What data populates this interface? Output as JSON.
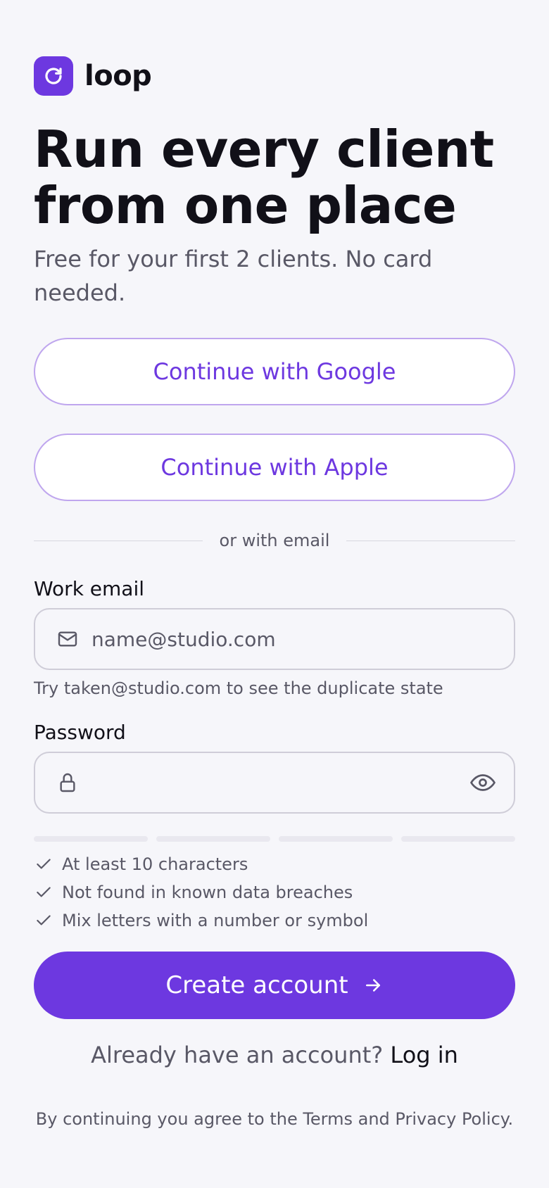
{
  "brand": {
    "name": "loop",
    "icon": "refresh-icon",
    "color": "#6d38e0"
  },
  "hero": {
    "title": "Run every client from one place",
    "subtitle": "Free for your first 2 clients. No card needed."
  },
  "oauth": {
    "google_label": "Continue with Google",
    "apple_label": "Continue with Apple"
  },
  "divider_text": "or with email",
  "email": {
    "label": "Work email",
    "placeholder": "name@studio.com",
    "icon": "mail-icon",
    "hint": "Try taken@studio.com to see the duplicate state"
  },
  "password": {
    "label": "Password",
    "value": "",
    "icon": "lock-icon",
    "toggle_icon": "eye-icon",
    "strength_segments_filled": 0,
    "strength_segments_total": 4,
    "rules": [
      "At least 10 characters",
      "Not found in known data breaches",
      "Mix letters with a number or symbol"
    ]
  },
  "cta": {
    "label": "Create account",
    "icon": "arrow-right-icon"
  },
  "login": {
    "prompt": "Already have an account?",
    "link": "Log in"
  },
  "legal": "By continuing you agree to the Terms and Privacy Policy.",
  "colors": {
    "accent": "#6d38e0",
    "background": "#f6f6fa",
    "text": "#111018",
    "muted": "#595866"
  }
}
